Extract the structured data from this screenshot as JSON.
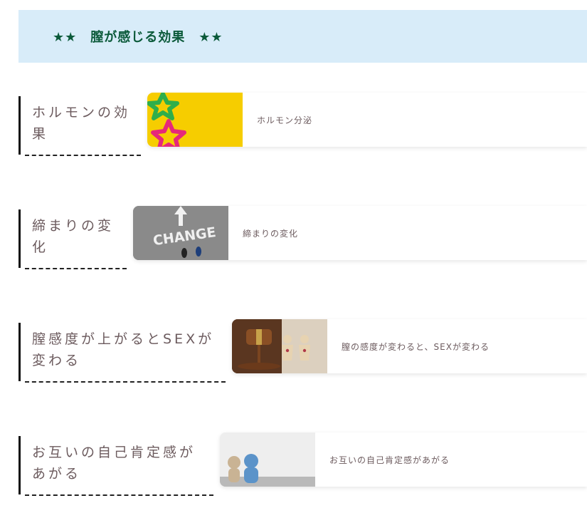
{
  "banner": {
    "title": "★★　膣が感じる効果　★★"
  },
  "sections": [
    {
      "heading_line1": "ホルモンの効",
      "heading_line2": "果",
      "card_label": "ホルモン分泌",
      "thumbnail": "colorful-stars-image"
    },
    {
      "heading_line1": "締まりの変",
      "heading_line2": "化",
      "card_label": "締まりの変化",
      "thumbnail": "change-arrow-image",
      "thumbnail_text": "CHANGE"
    },
    {
      "heading_line1": "膣感度が上がるとSEXが",
      "heading_line2": "変わる",
      "card_label": "膣の感度が変わると、SEXが変わる",
      "thumbnail": "gavel-couple-image"
    },
    {
      "heading_line1": "お互いの自己肯定感が",
      "heading_line2": "あがる",
      "card_label": "お互いの自己肯定感があがる",
      "thumbnail": "teddy-bears-image"
    }
  ],
  "colors": {
    "banner_bg": "#d8ecf9",
    "banner_text": "#0b5a3a",
    "heading_text": "#6c5b5e"
  }
}
